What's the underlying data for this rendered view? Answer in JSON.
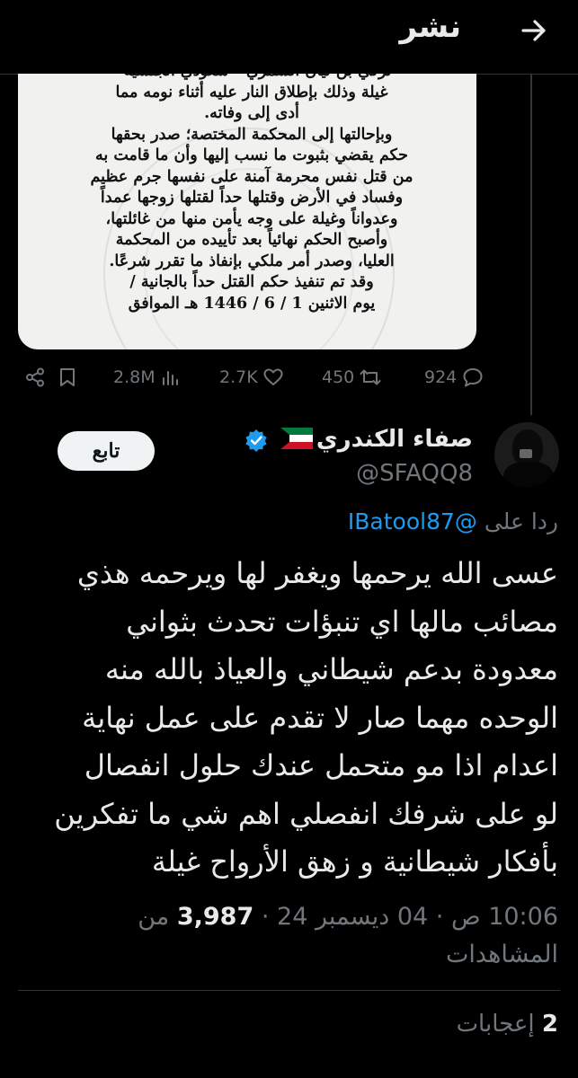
{
  "header": {
    "title": "نشر",
    "back_icon": "arrow-right-icon"
  },
  "image_card": {
    "lines": [
      "تركي بن تيان الشمري - سعودي الجنسية -",
      "غيلة وذلك بإطلاق النار عليه أثناء نومه مما",
      "أدى إلى وفاته.",
      "وبإحالتها إلى المحكمة المختصة؛ صدر بحقها",
      "حكم يقضي بثبوت ما نسب إليها وأن ما قامت به",
      "من قتل نفس محرمة آمنة على نفسها جرم عظيم",
      "وفساد في الأرض وقتلها حداً لقتلها زوجها عمداً",
      "وعدواناً وغيلة على وجه يأمن منها من غائلتها،",
      "وأصبح الحكم نهائياً بعد تأييده من المحكمة",
      "العليا، وصدر أمر ملكي بإنفاذ ما تقرر شرعًا.",
      "وقد تم تنفيذ حكم القتل حداً بالجانية /",
      "يوم الاثنين 1 / 6 / 1446 هـ الموافق"
    ]
  },
  "stats": {
    "views": "2.8M",
    "likes": "2.7K",
    "retweets": "450",
    "replies": "924"
  },
  "reply_tweet": {
    "name": "صفاء الكندري",
    "handle": "@SFAQQ8",
    "follow_label": "تابع",
    "reply_prefix": "ردا على",
    "reply_to": "@IBatool87",
    "body_lines": [
      "عسى الله يرحمها ويغفر لها ويرحمه هذي",
      "مصائب مالها اي تنبؤات تحدث بثواني",
      "معدودة بدعم شيطاني والعياذ بالله منه",
      "الوحده مهما صار لا تقدم على عمل نهاية",
      "اعدام اذا مو متحمل عندك حلول انفصال",
      "لو على شرفك انفصلي اهم شي ما تفكرين",
      "بأفكار شيطانية و زهق الأرواح غيلة"
    ],
    "time": "10:06 ص",
    "date": "04 ديسمبر 24",
    "views_count": "3,987",
    "views_label": "من المشاهدات",
    "likes_count": "2",
    "likes_label": "إعجابات"
  },
  "colors": {
    "accent": "#1d9bf0",
    "muted": "#71767b",
    "text": "#e7e9ea",
    "background": "#000000"
  }
}
